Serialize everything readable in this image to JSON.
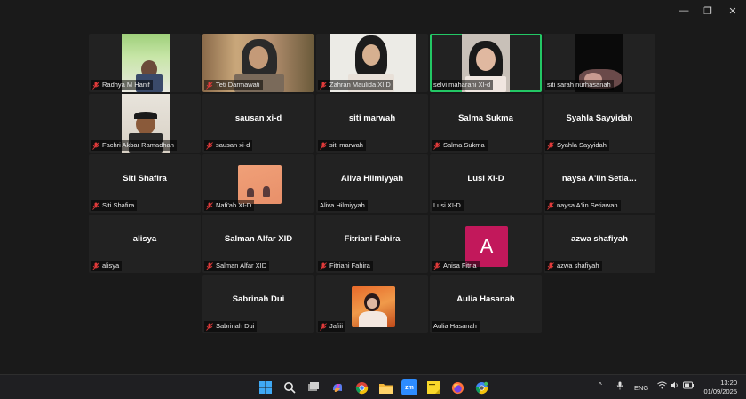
{
  "window": {
    "minimize_glyph": "—",
    "maximize_glyph": "❐",
    "close_glyph": "✕"
  },
  "participants": [
    {
      "name": "Radhya M Hanif",
      "video": true
    },
    {
      "name": "Teti Darmawati",
      "video": true
    },
    {
      "name": "Zahran Maulida XI D",
      "video": true
    },
    {
      "name": "selvi maharani XI-d",
      "video": true,
      "active_speaker": true
    },
    {
      "name": "siti sarah nurhasanah",
      "video": true
    },
    {
      "name": "Fachri Akbar Ramadhan",
      "video": true
    },
    {
      "name": "sausan xi-d",
      "display": "sausan xi-d",
      "video": false
    },
    {
      "name": "siti marwah",
      "display": "siti marwah",
      "video": false
    },
    {
      "name": "Salma Sukma",
      "display": "Salma Sukma",
      "video": false
    },
    {
      "name": "Syahla Sayyidah",
      "display": "Syahla Sayyidah",
      "video": false
    },
    {
      "name": "Siti Shafira",
      "display": "Siti Shafira",
      "video": false
    },
    {
      "name": "Nafi'ah XI-D",
      "video": false,
      "profile_picture": true
    },
    {
      "name": "Aliva Hilmiyyah",
      "display": "Aliva Hilmiyyah",
      "video": false
    },
    {
      "name": "Lusi XI-D",
      "display": "Lusi XI-D",
      "video": false
    },
    {
      "name": "naysa A'lin Setiawan",
      "display": "naysa  A'lin  Setia…",
      "video": false
    },
    {
      "name": "alisya",
      "display": "alisya",
      "video": false
    },
    {
      "name": "Salman Alfar XID",
      "display": "Salman Alfar XID",
      "video": false
    },
    {
      "name": "Fitriani Fahira",
      "display": "Fitriani Fahira",
      "video": false
    },
    {
      "name": "Anisa Fitria",
      "video": false,
      "avatar_letter": "A",
      "avatar_color": "#c2185b"
    },
    {
      "name": "azwa shafiyah",
      "display": "azwa shafiyah",
      "video": false
    },
    {
      "name": "Sabrinah Dui",
      "display": "Sabrinah Dui",
      "video": false
    },
    {
      "name": "Jafiii",
      "video": false,
      "profile_picture": true
    },
    {
      "name": "Aulia Hasanah",
      "display": "Aulia Hasanah",
      "video": false
    }
  ],
  "taskbar": {
    "apps": [
      "windows-start-icon",
      "search-icon",
      "task-view-icon",
      "copilot-icon",
      "chrome-icon",
      "file-explorer-icon",
      "zoom-icon",
      "sticky-notes-icon",
      "firefox-icon",
      "chrome-dev-icon"
    ],
    "zoom_label": "zm",
    "language": "ENG",
    "time": "13:20",
    "date": "01/09/2025"
  },
  "colors": {
    "active_border": "#23c865",
    "mute_red": "#e03a3a",
    "avatar_pink": "#c2185b"
  }
}
